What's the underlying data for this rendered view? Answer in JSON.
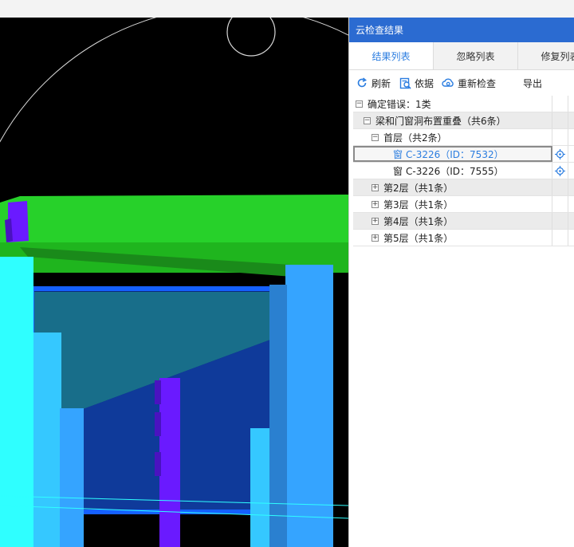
{
  "panel": {
    "title": "云检查结果",
    "tabs": [
      {
        "label": "结果列表",
        "active": true
      },
      {
        "label": "忽略列表",
        "active": false
      },
      {
        "label": "修复列表",
        "active": false
      }
    ],
    "toolbar": {
      "refresh_label": "刷新",
      "basis_label": "依据",
      "recheck_label": "重新检查",
      "export_label": "导出"
    },
    "tree": [
      {
        "label": "确定错误：1类",
        "expander": "−"
      },
      {
        "label": "梁和门窗洞布置重叠（共6条）",
        "expander": "−"
      },
      {
        "label": "首层（共2条）",
        "expander": "−"
      },
      {
        "label": "C-3226（ID：7532）",
        "icon": "窗",
        "selected": true
      },
      {
        "label": "C-3226（ID：7555）",
        "icon": "窗"
      },
      {
        "label": "第2层（共1条）",
        "expander": "+"
      },
      {
        "label": "第3层（共1条）",
        "expander": "+"
      },
      {
        "label": "第4层（共1条）",
        "expander": "+"
      },
      {
        "label": "第5层（共1条）",
        "expander": "+"
      }
    ]
  },
  "colors": {
    "accent": "#2b7de0",
    "titlebar": "#2b6bd1",
    "beam_green": "#27d12a",
    "column_cyan": "#2fffff",
    "column_blue": "#35a4ff",
    "window_frame": "#1560ff",
    "purple": "#6a1aff"
  }
}
